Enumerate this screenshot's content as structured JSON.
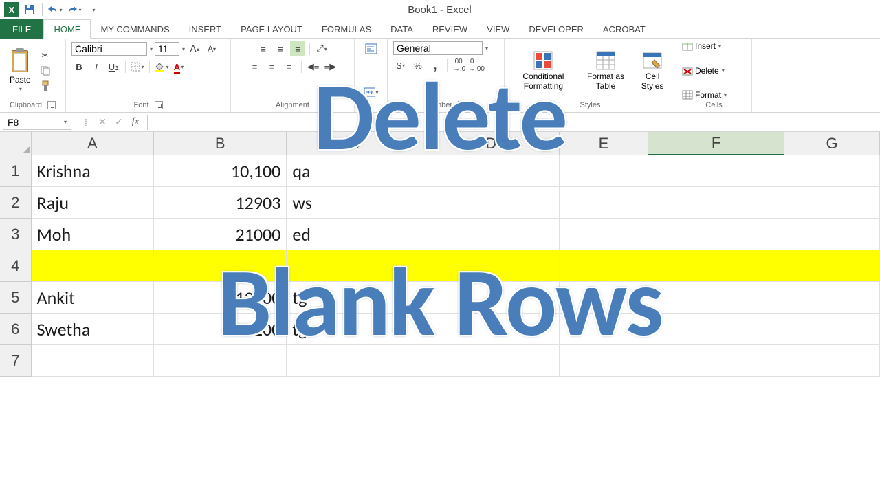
{
  "app_title": "Book1 - Excel",
  "tabs": {
    "file": "FILE",
    "list": [
      "HOME",
      "MY COMMANDS",
      "INSERT",
      "PAGE LAYOUT",
      "FORMULAS",
      "DATA",
      "REVIEW",
      "VIEW",
      "DEVELOPER",
      "ACROBAT"
    ],
    "active": 0
  },
  "ribbon": {
    "clipboard": {
      "label": "Clipboard",
      "paste": "Paste"
    },
    "font": {
      "label": "Font",
      "name": "Calibri",
      "size": "11",
      "bold": "B",
      "italic": "I",
      "underline": "U"
    },
    "alignment": {
      "label": "Alignment"
    },
    "number": {
      "label": "Number",
      "format": "General"
    },
    "styles": {
      "label": "Styles",
      "conditional": "Conditional Formatting",
      "table": "Format as Table",
      "cell": "Cell Styles"
    },
    "cells": {
      "label": "Cells",
      "insert": "Insert",
      "delete": "Delete",
      "format": "Format"
    }
  },
  "name_box": "F8",
  "formula_bar": "",
  "columns": [
    "A",
    "B",
    "C",
    "D",
    "E",
    "F",
    "G"
  ],
  "selected_col": "F",
  "rows": [
    {
      "n": "1",
      "A": "Krishna",
      "B": "10,100",
      "C": "qa"
    },
    {
      "n": "2",
      "A": "Raju",
      "B": "12903",
      "C": "ws"
    },
    {
      "n": "3",
      "A": "Moh",
      "B": "21000",
      "C": "ed"
    },
    {
      "n": "4",
      "A": "",
      "B": "",
      "C": "",
      "highlight": true
    },
    {
      "n": "5",
      "A": "Ankit",
      "B": "12000",
      "C": "tg"
    },
    {
      "n": "6",
      "A": "Swetha",
      "B": "111200",
      "C": "tg"
    },
    {
      "n": "7",
      "A": "",
      "B": "",
      "C": ""
    }
  ],
  "overlay": {
    "line1": "Delete",
    "line2": "Blank Rows"
  }
}
